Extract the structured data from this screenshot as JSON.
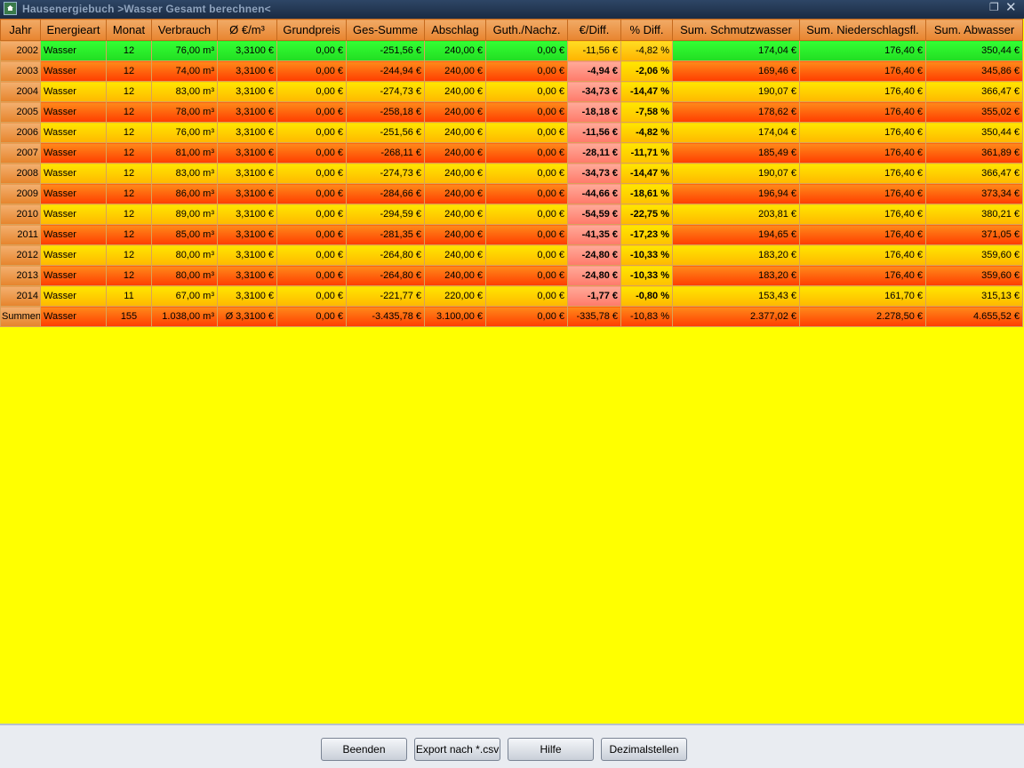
{
  "window": {
    "title": "Hausenergiebuch >Wasser Gesamt berechnen<"
  },
  "columns": [
    "Jahr",
    "Energieart",
    "Monat",
    "Verbrauch",
    "Ø  €/m³",
    "Grundpreis",
    "Ges-Summe",
    "Abschlag",
    "Guth./Nachz.",
    "€/Diff.",
    "% Diff.",
    "Sum. Schmutzwasser",
    "Sum. Niederschlagsfl.",
    "Sum. Abwasser"
  ],
  "rows": [
    [
      "2002",
      "Wasser",
      "12",
      "76,00 m³",
      "3,3100 €",
      "0,00 €",
      "-251,56 €",
      "240,00 €",
      "0,00 €",
      "-11,56 €",
      "-4,82 %",
      "174,04 €",
      "176,40 €",
      "350,44 €"
    ],
    [
      "2003",
      "Wasser",
      "12",
      "74,00 m³",
      "3,3100 €",
      "0,00 €",
      "-244,94 €",
      "240,00 €",
      "0,00 €",
      "-4,94 €",
      "-2,06 %",
      "169,46 €",
      "176,40 €",
      "345,86 €"
    ],
    [
      "2004",
      "Wasser",
      "12",
      "83,00 m³",
      "3,3100 €",
      "0,00 €",
      "-274,73 €",
      "240,00 €",
      "0,00 €",
      "-34,73 €",
      "-14,47 %",
      "190,07 €",
      "176,40 €",
      "366,47 €"
    ],
    [
      "2005",
      "Wasser",
      "12",
      "78,00 m³",
      "3,3100 €",
      "0,00 €",
      "-258,18 €",
      "240,00 €",
      "0,00 €",
      "-18,18 €",
      "-7,58 %",
      "178,62 €",
      "176,40 €",
      "355,02 €"
    ],
    [
      "2006",
      "Wasser",
      "12",
      "76,00 m³",
      "3,3100 €",
      "0,00 €",
      "-251,56 €",
      "240,00 €",
      "0,00 €",
      "-11,56 €",
      "-4,82 %",
      "174,04 €",
      "176,40 €",
      "350,44 €"
    ],
    [
      "2007",
      "Wasser",
      "12",
      "81,00 m³",
      "3,3100 €",
      "0,00 €",
      "-268,11 €",
      "240,00 €",
      "0,00 €",
      "-28,11 €",
      "-11,71 %",
      "185,49 €",
      "176,40 €",
      "361,89 €"
    ],
    [
      "2008",
      "Wasser",
      "12",
      "83,00 m³",
      "3,3100 €",
      "0,00 €",
      "-274,73 €",
      "240,00 €",
      "0,00 €",
      "-34,73 €",
      "-14,47 %",
      "190,07 €",
      "176,40 €",
      "366,47 €"
    ],
    [
      "2009",
      "Wasser",
      "12",
      "86,00 m³",
      "3,3100 €",
      "0,00 €",
      "-284,66 €",
      "240,00 €",
      "0,00 €",
      "-44,66 €",
      "-18,61 %",
      "196,94 €",
      "176,40 €",
      "373,34 €"
    ],
    [
      "2010",
      "Wasser",
      "12",
      "89,00 m³",
      "3,3100 €",
      "0,00 €",
      "-294,59 €",
      "240,00 €",
      "0,00 €",
      "-54,59 €",
      "-22,75 %",
      "203,81 €",
      "176,40 €",
      "380,21 €"
    ],
    [
      "2011",
      "Wasser",
      "12",
      "85,00 m³",
      "3,3100 €",
      "0,00 €",
      "-281,35 €",
      "240,00 €",
      "0,00 €",
      "-41,35 €",
      "-17,23 %",
      "194,65 €",
      "176,40 €",
      "371,05 €"
    ],
    [
      "2012",
      "Wasser",
      "12",
      "80,00 m³",
      "3,3100 €",
      "0,00 €",
      "-264,80 €",
      "240,00 €",
      "0,00 €",
      "-24,80 €",
      "-10,33 %",
      "183,20 €",
      "176,40 €",
      "359,60 €"
    ],
    [
      "2013",
      "Wasser",
      "12",
      "80,00 m³",
      "3,3100 €",
      "0,00 €",
      "-264,80 €",
      "240,00 €",
      "0,00 €",
      "-24,80 €",
      "-10,33 %",
      "183,20 €",
      "176,40 €",
      "359,60 €"
    ],
    [
      "2014",
      "Wasser",
      "11",
      "67,00 m³",
      "3,3100 €",
      "0,00 €",
      "-221,77 €",
      "220,00 €",
      "0,00 €",
      "-1,77 €",
      "-0,80 %",
      "153,43 €",
      "161,70 €",
      "315,13 €"
    ]
  ],
  "summary": [
    "Summen",
    "Wasser",
    "155",
    "1.038,00 m³",
    "Ø 3,3100 €",
    "0,00 €",
    "-3.435,78 €",
    "3.100,00 €",
    "0,00 €",
    "-335,78 €",
    "-10,83 %",
    "2.377,02 €",
    "2.278,50 €",
    "4.655,52 €"
  ],
  "buttons": {
    "close": "Beenden",
    "export": "Export nach *.csv",
    "help": "Hilfe",
    "decimals": "Dezimalstellen"
  },
  "colors": {
    "row_alt_yellow": "#ffd000",
    "row_alt_red": "#ff5a00",
    "row_best_green": "#22ee22",
    "background": "#ffff00"
  }
}
